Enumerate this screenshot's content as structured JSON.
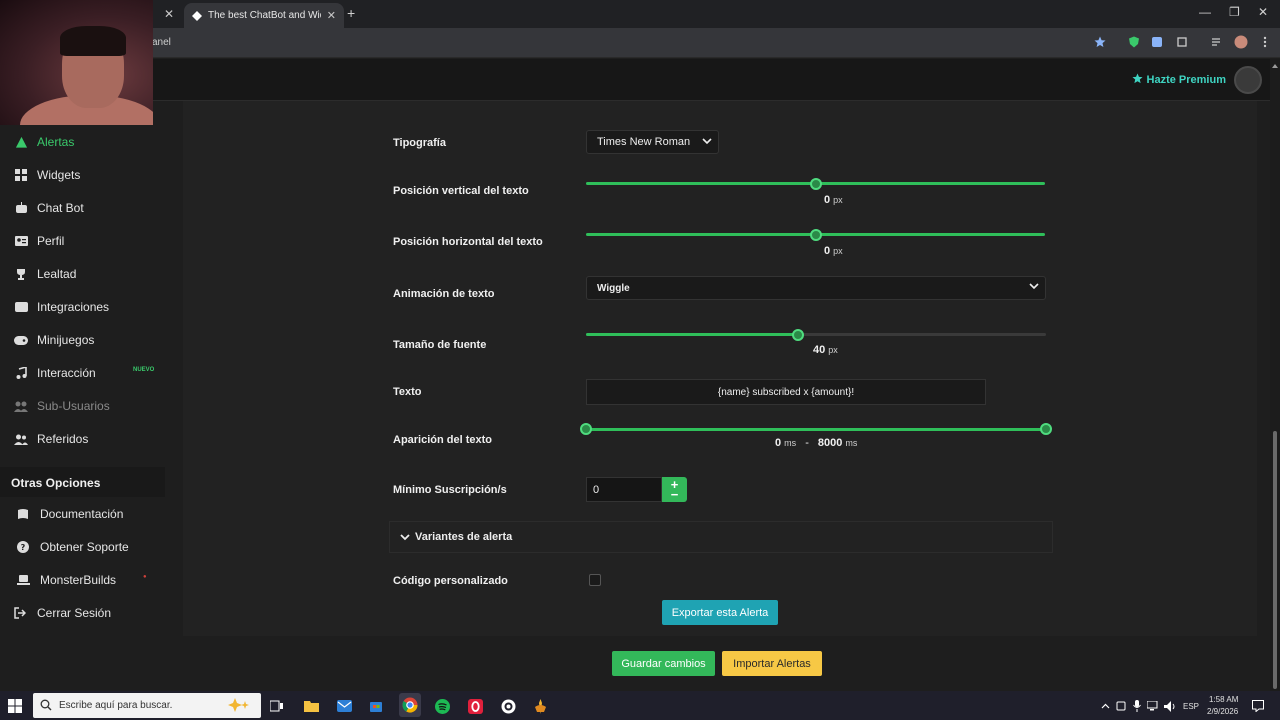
{
  "browser": {
    "tab_title": "The best ChatBot and Widgets",
    "url_fragment": "anel",
    "new_tab": "+"
  },
  "header": {
    "premium_label": "Hazte Premium"
  },
  "sidebar": {
    "items": [
      {
        "label": "Alertas",
        "icon": "warning-icon",
        "state": "active"
      },
      {
        "label": "Widgets",
        "icon": "grid-icon",
        "state": "normal"
      },
      {
        "label": "Chat Bot",
        "icon": "robot-icon",
        "state": "normal"
      },
      {
        "label": "Perfil",
        "icon": "id-card-icon",
        "state": "normal"
      },
      {
        "label": "Lealtad",
        "icon": "trophy-icon",
        "state": "normal"
      },
      {
        "label": "Integraciones",
        "icon": "plug-icon",
        "state": "normal"
      },
      {
        "label": "Minijuegos",
        "icon": "gamepad-icon",
        "state": "normal"
      },
      {
        "label": "Interacción",
        "icon": "music-icon",
        "state": "normal",
        "badge": "NUEVO"
      },
      {
        "label": "Sub-Usuarios",
        "icon": "users-icon",
        "state": "disabled"
      },
      {
        "label": "Referidos",
        "icon": "user-friends-icon",
        "state": "normal"
      }
    ],
    "section_title": "Otras Opciones",
    "other_items": [
      {
        "label": "Documentación",
        "icon": "book-icon"
      },
      {
        "label": "Obtener Soporte",
        "icon": "question-icon"
      },
      {
        "label": "MonsterBuilds",
        "icon": "laptop-icon"
      },
      {
        "label": "Cerrar Sesión",
        "icon": "logout-icon"
      }
    ]
  },
  "form": {
    "typography": {
      "label": "Tipografía",
      "value": "Times New Roman"
    },
    "vertical_position": {
      "label": "Posición vertical del texto",
      "value": "0",
      "unit": "px",
      "fraction": 0.5
    },
    "horizontal_position": {
      "label": "Posición horizontal del texto",
      "value": "0",
      "unit": "px",
      "fraction": 0.5
    },
    "text_animation": {
      "label": "Animación de texto",
      "value": "Wiggle"
    },
    "font_size": {
      "label": "Tamaño de fuente",
      "value": "40",
      "unit": "px",
      "fraction": 0.46
    },
    "text": {
      "label": "Texto",
      "value": "{name} subscribed x {amount}!"
    },
    "text_appearance": {
      "label": "Aparición del texto",
      "min": "0",
      "max": "8000",
      "unit": "ms",
      "separator": "-"
    },
    "min_subs": {
      "label": "Mínimo Suscripción/s",
      "value": "0"
    },
    "variants": {
      "label": "Variantes de alerta"
    },
    "custom_code": {
      "label": "Código personalizado",
      "checked": false
    },
    "export_button": "Exportar esta Alerta"
  },
  "actions": {
    "save": "Guardar cambios",
    "import": "Importar Alertas"
  },
  "taskbar": {
    "search_placeholder": "Escribe aquí para buscar.",
    "lang": "ESP",
    "time": "1:58 AM",
    "date": "2/9/2026"
  },
  "colors": {
    "accent_green": "#33b85a",
    "accent_teal": "#1fa3b3",
    "accent_yellow": "#f7c845",
    "premium": "#3fd4c2"
  }
}
